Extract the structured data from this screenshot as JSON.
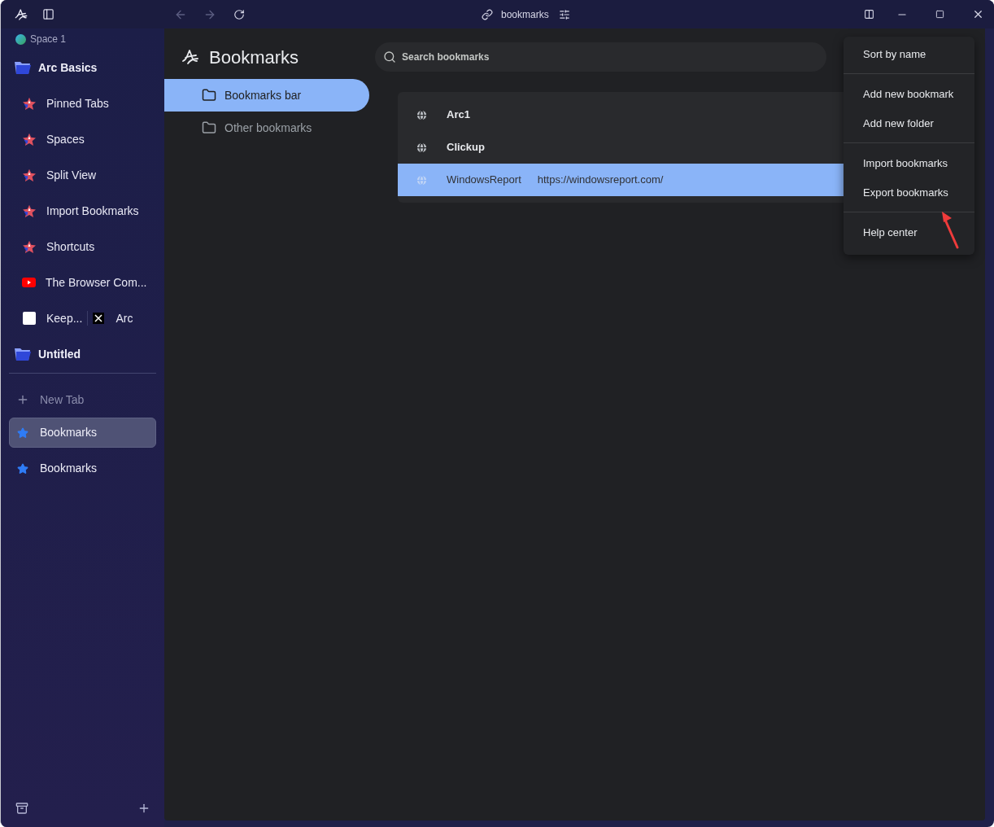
{
  "titlebar": {
    "address": "bookmarks"
  },
  "sidebar": {
    "space": "Space 1",
    "folders": [
      {
        "name": "Arc Basics",
        "children": [
          {
            "kind": "arc",
            "title": "Pinned Tabs"
          },
          {
            "kind": "arc",
            "title": "Spaces"
          },
          {
            "kind": "arc",
            "title": "Split View"
          },
          {
            "kind": "arc",
            "title": "Import Bookmarks"
          },
          {
            "kind": "arc",
            "title": "Shortcuts"
          },
          {
            "kind": "video",
            "title": "The Browser Com..."
          },
          {
            "kind": "split",
            "tabs": [
              "Keep...",
              "Arc"
            ]
          }
        ]
      },
      {
        "name": "Untitled"
      }
    ],
    "new_tab": "New Tab",
    "tabs": [
      {
        "label": "Bookmarks",
        "selected": true
      },
      {
        "label": "Bookmarks",
        "selected": false
      }
    ]
  },
  "page": {
    "title": "Bookmarks",
    "search": {
      "placeholder": "Search bookmarks"
    },
    "folders": [
      {
        "label": "Bookmarks bar",
        "selected": true
      },
      {
        "label": "Other bookmarks",
        "selected": false
      }
    ],
    "bookmarks": [
      {
        "title": "Arc1",
        "selected": false
      },
      {
        "title": "Clickup",
        "selected": false
      },
      {
        "title": "WindowsReport",
        "url": "https://windowsreport.com/",
        "selected": true
      }
    ]
  },
  "menu": {
    "sections": [
      [
        "Sort by name"
      ],
      [
        "Add new bookmark",
        "Add new folder"
      ],
      [
        "Import bookmarks",
        "Export bookmarks"
      ],
      [
        "Help center"
      ]
    ]
  }
}
